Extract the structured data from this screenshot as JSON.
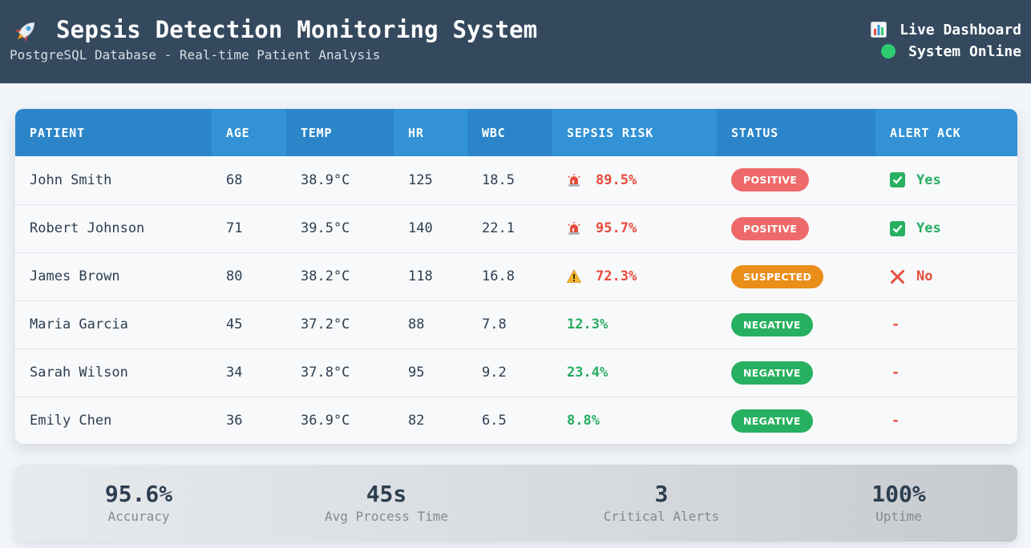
{
  "header": {
    "title": "Sepsis Detection Monitoring System",
    "subtitle": "PostgreSQL Database - Real-time Patient Analysis",
    "live_label": "Live Dashboard",
    "status_label": "System Online",
    "title_icon": "rocket-icon",
    "live_icon": "bar-chart-icon",
    "status_color": "#2ecc71"
  },
  "table": {
    "columns": [
      "PATIENT",
      "AGE",
      "TEMP",
      "HR",
      "WBC",
      "SEPSIS RISK",
      "STATUS",
      "ALERT ACK"
    ],
    "rows": [
      {
        "patient": "John Smith",
        "age": "68",
        "temp": "38.9°C",
        "hr": "125",
        "wbc": "18.5",
        "risk": "89.5%",
        "risk_icon": "siren-icon",
        "status": "POSITIVE",
        "ack": "Yes",
        "ack_icon": "checkbox-icon"
      },
      {
        "patient": "Robert Johnson",
        "age": "71",
        "temp": "39.5°C",
        "hr": "140",
        "wbc": "22.1",
        "risk": "95.7%",
        "risk_icon": "siren-icon",
        "status": "POSITIVE",
        "ack": "Yes",
        "ack_icon": "checkbox-icon"
      },
      {
        "patient": "James Brown",
        "age": "80",
        "temp": "38.2°C",
        "hr": "118",
        "wbc": "16.8",
        "risk": "72.3%",
        "risk_icon": "warning-icon",
        "status": "SUSPECTED",
        "ack": "No",
        "ack_icon": "cross-icon"
      },
      {
        "patient": "Maria Garcia",
        "age": "45",
        "temp": "37.2°C",
        "hr": "88",
        "wbc": "7.8",
        "risk": "12.3%",
        "risk_icon": "",
        "status": "NEGATIVE",
        "ack": "-",
        "ack_icon": ""
      },
      {
        "patient": "Sarah Wilson",
        "age": "34",
        "temp": "37.8°C",
        "hr": "95",
        "wbc": "9.2",
        "risk": "23.4%",
        "risk_icon": "",
        "status": "NEGATIVE",
        "ack": "-",
        "ack_icon": ""
      },
      {
        "patient": "Emily Chen",
        "age": "36",
        "temp": "36.9°C",
        "hr": "82",
        "wbc": "6.5",
        "risk": "8.8%",
        "risk_icon": "",
        "status": "NEGATIVE",
        "ack": "-",
        "ack_icon": ""
      }
    ]
  },
  "stats": [
    {
      "value": "95.6%",
      "label": "Accuracy"
    },
    {
      "value": "45s",
      "label": "Avg Process Time"
    },
    {
      "value": "3",
      "label": "Critical Alerts"
    },
    {
      "value": "100%",
      "label": "Uptime"
    }
  ],
  "colors": {
    "header_bg": "#34495e",
    "table_header": "#3292d5",
    "positive": "#ee6a6a",
    "suspected": "#ea8e1a",
    "negative": "#27b060",
    "risk_high": "#e74c3c",
    "risk_low": "#27ae60"
  }
}
